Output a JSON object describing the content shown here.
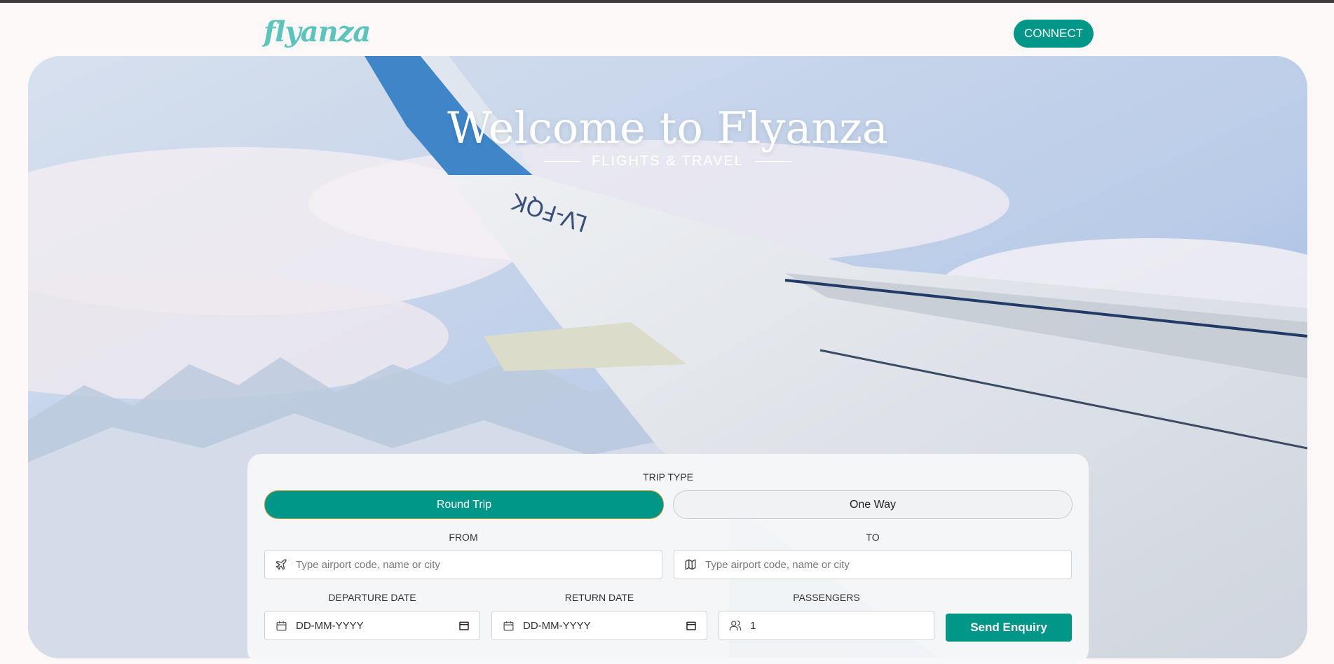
{
  "brand": {
    "logo_text": "flyanza"
  },
  "header": {
    "connect_label": "CONNECT"
  },
  "hero": {
    "title": "Welcome to Flyanza",
    "subtitle": "FLIGHTS & TRAVEL",
    "wing_registration": "LV-FQK"
  },
  "form": {
    "trip_type_label": "TRIP TYPE",
    "trip_options": [
      {
        "label": "Round Trip",
        "selected": true
      },
      {
        "label": "One Way",
        "selected": false
      }
    ],
    "from": {
      "label": "FROM",
      "placeholder": "Type airport code, name or city",
      "icon": "plane-icon"
    },
    "to": {
      "label": "TO",
      "placeholder": "Type airport code, name or city",
      "icon": "map-icon"
    },
    "departure": {
      "label": "DEPARTURE DATE",
      "placeholder": "DD-MM-YYYY",
      "icon": "calendar-icon"
    },
    "return": {
      "label": "RETURN DATE",
      "placeholder": "DD-MM-YYYY",
      "icon": "calendar-icon"
    },
    "passengers": {
      "label": "PASSENGERS",
      "value": "1",
      "icon": "users-icon"
    },
    "submit_label": "Send Enquiry"
  },
  "colors": {
    "accent": "#009688",
    "logo": "#5cc4bd",
    "page_background": "#fcf8f7"
  }
}
